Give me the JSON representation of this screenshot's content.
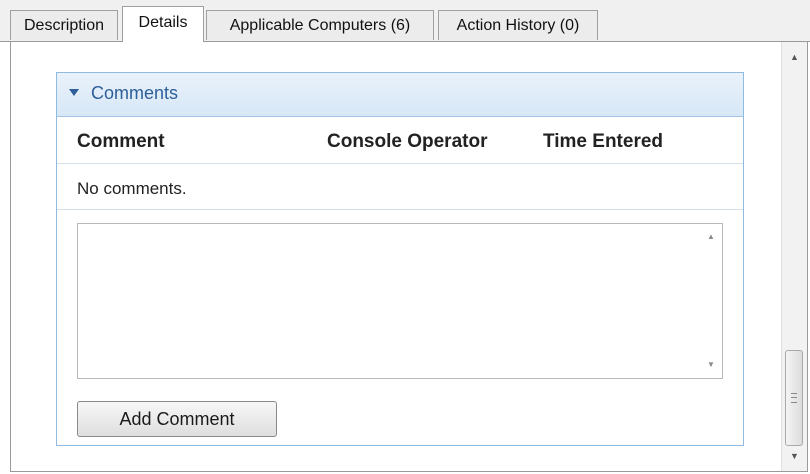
{
  "tabs": [
    {
      "label": "Description",
      "active": false
    },
    {
      "label": "Details",
      "active": true
    },
    {
      "label": "Applicable Computers (6)",
      "active": false
    },
    {
      "label": "Action History (0)",
      "active": false
    }
  ],
  "comments": {
    "title": "Comments",
    "columns": [
      "Comment",
      "Console Operator",
      "Time Entered"
    ],
    "empty_message": "No comments.",
    "input_value": "",
    "add_button_label": "Add Comment"
  },
  "icons": {
    "collapse": "collapse-triangle-icon",
    "scroll_up": "scroll-up-arrow-icon",
    "scroll_down": "scroll-down-arrow-icon"
  },
  "colors": {
    "section_title": "#2d5f9a",
    "section_border": "#8fbbe0",
    "section_header_bg": "#d7e7f6"
  }
}
